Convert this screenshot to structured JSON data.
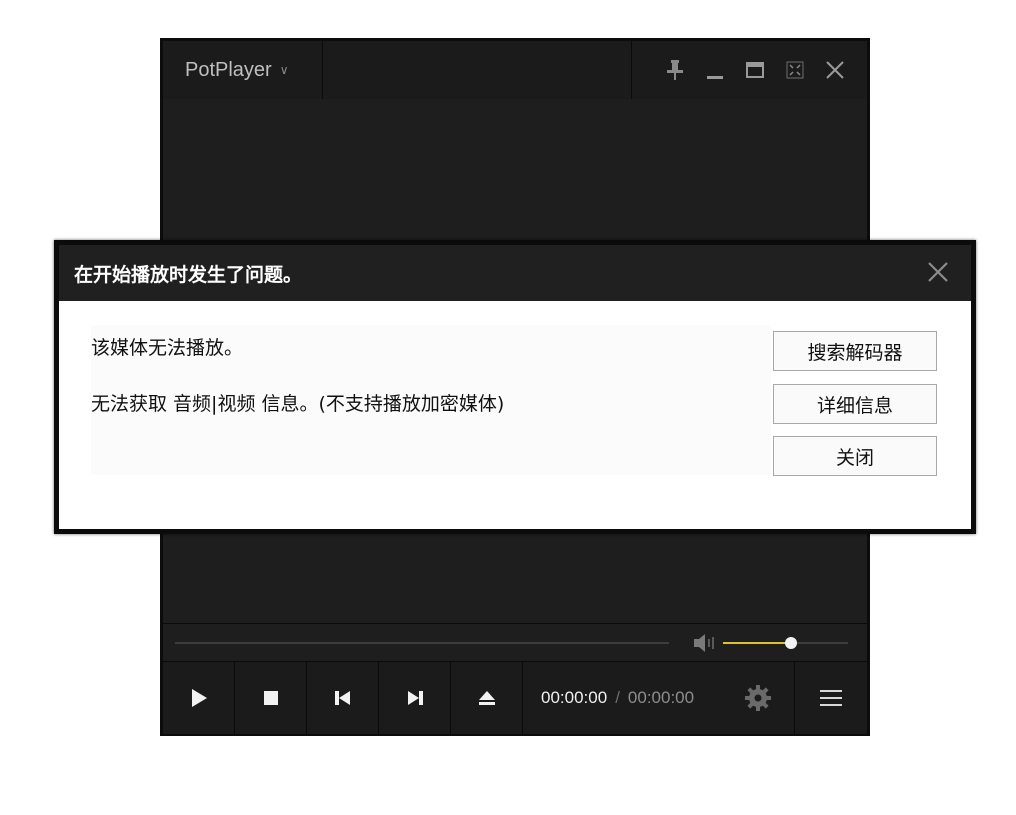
{
  "player": {
    "title": "PotPlayer",
    "title_chevron": "∨",
    "window_buttons": [
      "pin-icon",
      "minimize-icon",
      "maximize-icon",
      "fullscreen-icon",
      "close-icon"
    ],
    "volume_fraction": 0.54,
    "time": {
      "current": "00:00:00",
      "separator": "/",
      "total": "00:00:00"
    },
    "controls": [
      "play-icon",
      "stop-icon",
      "previous-icon",
      "next-icon",
      "eject-icon",
      "gear-icon",
      "menu-icon"
    ]
  },
  "dialog": {
    "title": "在开始播放时发生了问题。",
    "close_glyph": "✕",
    "messages": [
      "该媒体无法播放。",
      "无法获取 音频|视频 信息。(不支持播放加密媒体)"
    ],
    "buttons": {
      "search_codec": "搜索解码器",
      "details": "详细信息",
      "close": "关闭"
    }
  },
  "colors": {
    "player_bg": "#1e1e1e",
    "volume_accent": "#e0c12c",
    "dialog_title_bg": "#202020"
  }
}
